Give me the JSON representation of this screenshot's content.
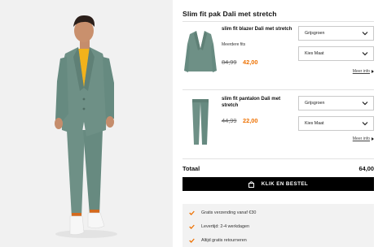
{
  "product_title": "Slim fit pak Dali met stretch",
  "items": [
    {
      "name": "slim fit blazer Dali met stretch",
      "fits": "Meerdere fits",
      "old_price": "84,99",
      "new_price": "42,00",
      "color_select": "Grijsgroen",
      "size_select": "Kies Maat",
      "more_info": "Meer info",
      "thumb_icon": "blazer-icon"
    },
    {
      "name": "slim fit pantalon Dali met stretch",
      "old_price": "44,99",
      "new_price": "22,00",
      "color_select": "Grijsgroen",
      "size_select": "Kies Maat",
      "more_info": "Meer info",
      "thumb_icon": "trousers-icon"
    }
  ],
  "total": {
    "label": "Totaal",
    "value": "64,00"
  },
  "buy_button": {
    "label": "KLIK EN BESTEL",
    "icon": "shopping-bag-icon"
  },
  "usps": [
    "Gratis verzending vanaf €30",
    "Levertijd: 2-4 werkdagen",
    "Altijd gratis retourneren"
  ],
  "colors": {
    "suit": "#6e9086",
    "sale": "#ee7203",
    "check": "#ee7203",
    "button": "#000000"
  }
}
